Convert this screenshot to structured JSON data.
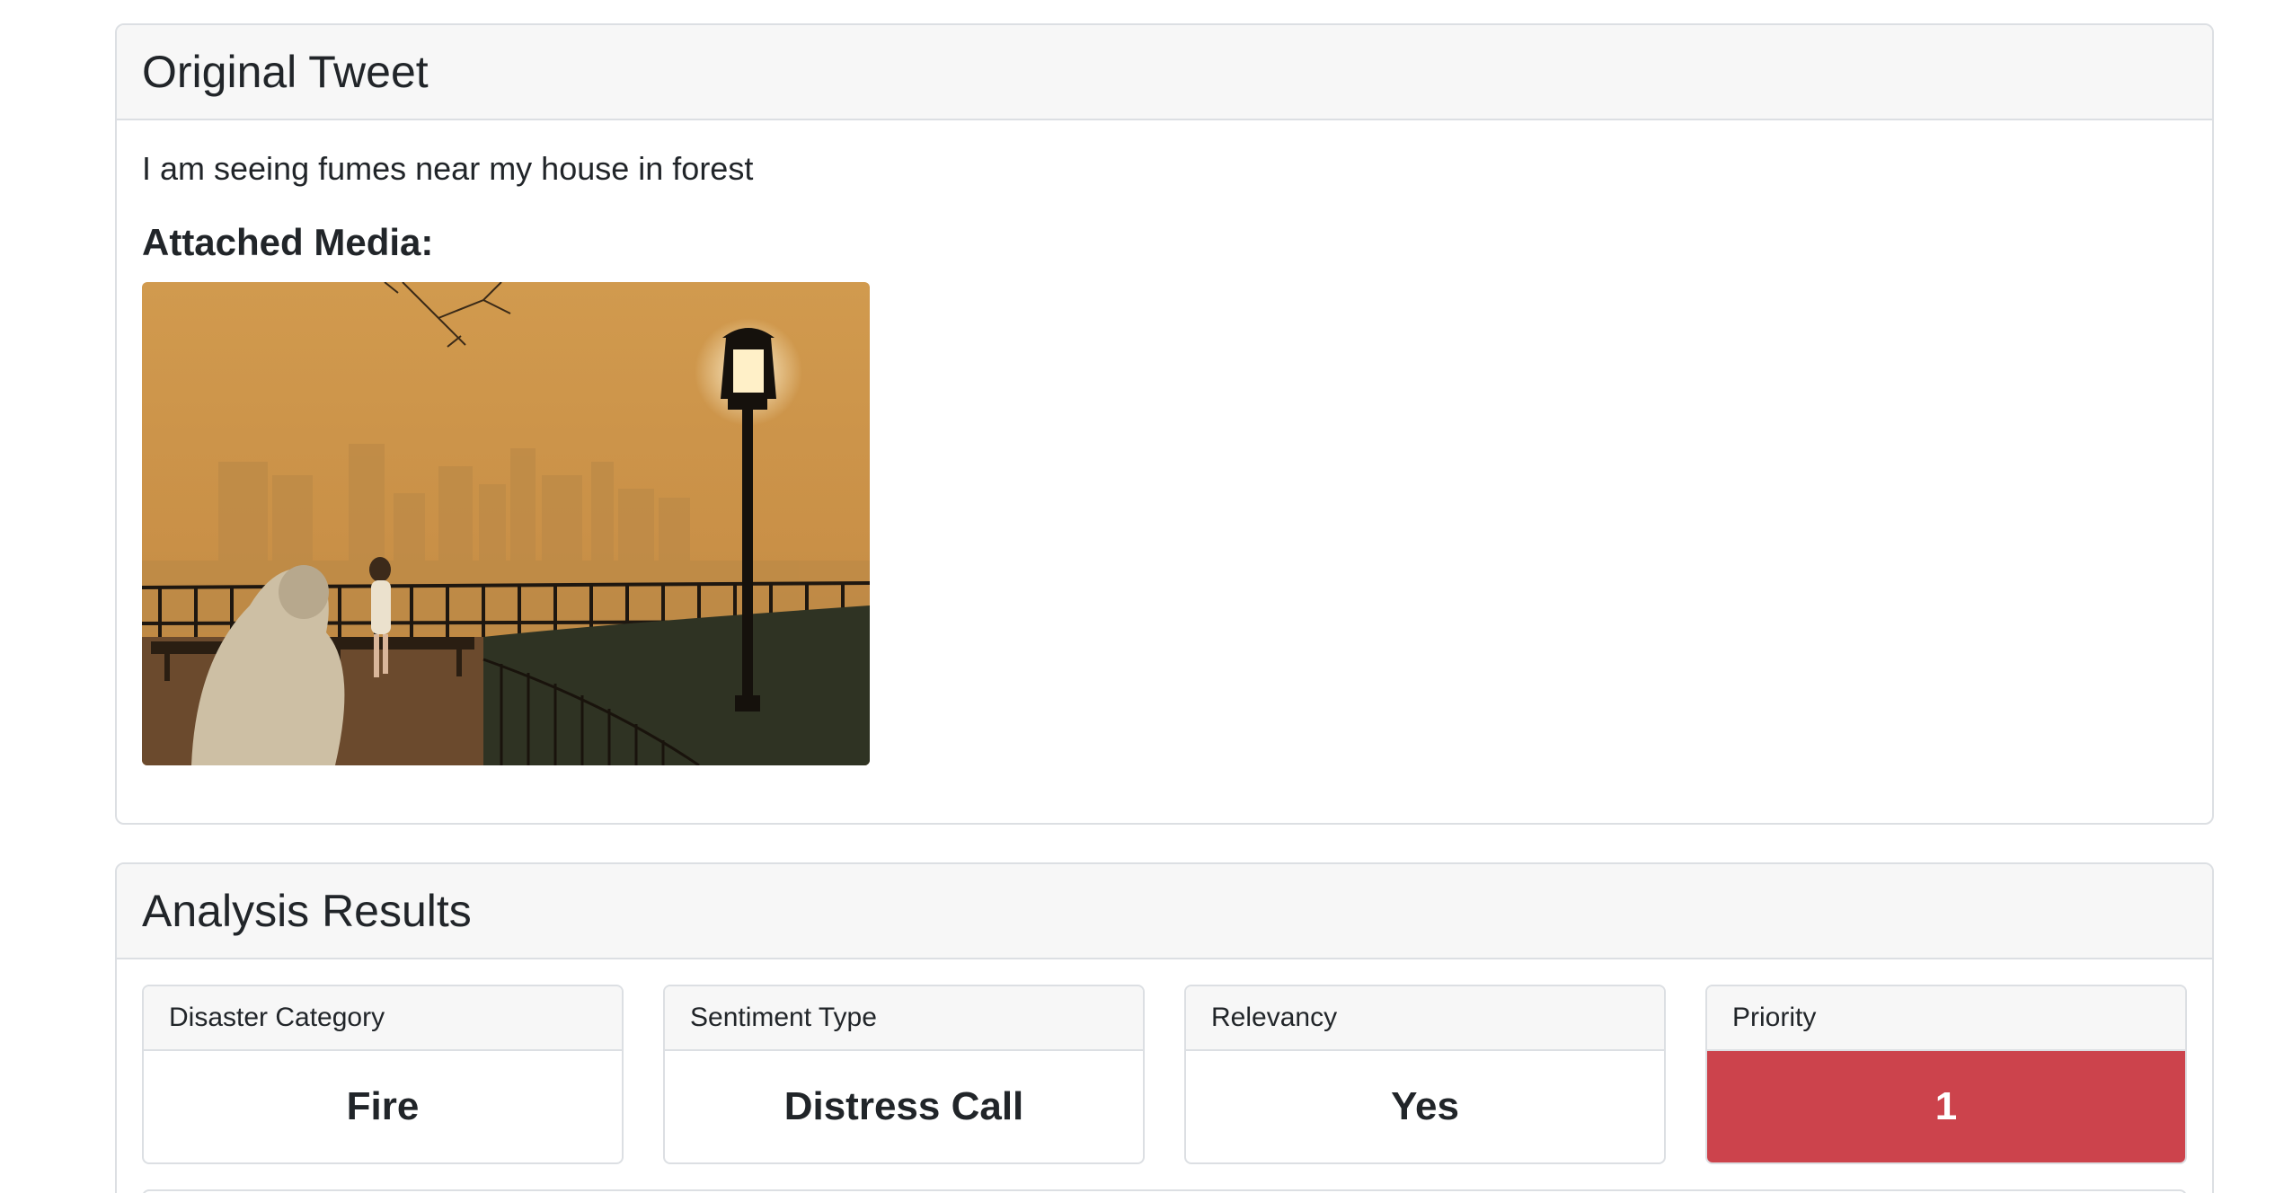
{
  "tweet": {
    "heading": "Original Tweet",
    "text": "I am seeing fumes near my house in forest",
    "media_heading": "Attached Media:"
  },
  "analysis": {
    "heading": "Analysis Results",
    "results": [
      {
        "label": "Disaster Category",
        "value": "Fire"
      },
      {
        "label": "Sentiment Type",
        "value": "Distress Call"
      },
      {
        "label": "Relevancy",
        "value": "Yes"
      },
      {
        "label": "Priority",
        "value": "1"
      }
    ]
  },
  "colors": {
    "priority_high": "#cc434c",
    "card_header_bg": "#f7f7f7",
    "border": "#dcdfe3"
  }
}
